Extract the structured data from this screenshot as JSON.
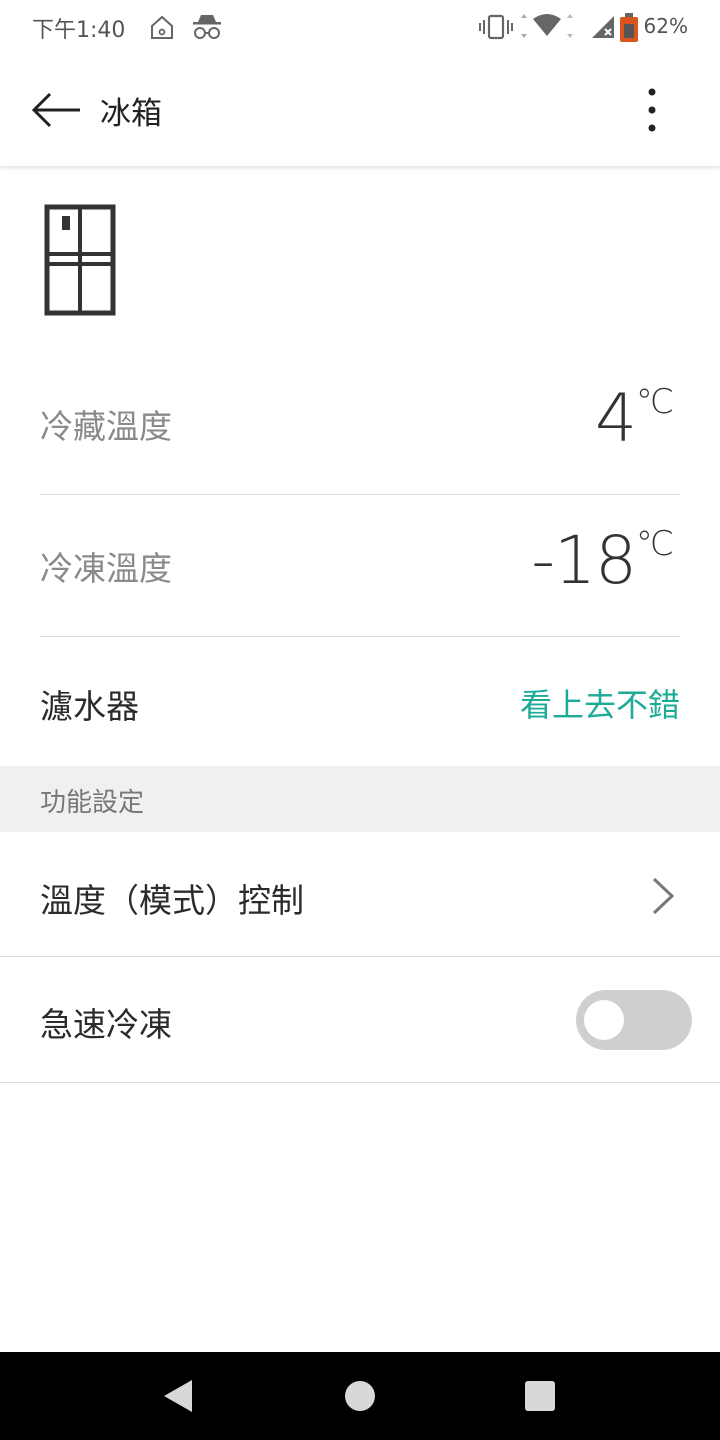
{
  "status_bar": {
    "time": "下午1:40",
    "battery": "62%",
    "icons": [
      "home-icon",
      "incognito-icon",
      "vibrate-icon",
      "wifi-icon",
      "signal-icon",
      "battery-icon"
    ]
  },
  "app_bar": {
    "title": "冰箱",
    "back_icon": "arrow-left-icon",
    "menu_icon": "more-vertical-icon"
  },
  "device": {
    "icon": "fridge-icon"
  },
  "readings": {
    "fridge_label": "冷藏溫度",
    "fridge_value": "4",
    "freezer_label": "冷凍溫度",
    "freezer_value": "-18",
    "unit": "℃",
    "filter_label": "濾水器",
    "filter_status": "看上去不錯"
  },
  "section": {
    "title": "功能設定"
  },
  "settings": {
    "mode_control_label": "溫度（模式）控制",
    "quick_freeze_label": "急速冷凍",
    "quick_freeze_on": false
  },
  "colors": {
    "accent": "#1bab97",
    "toggle_off": "#cfcfcf",
    "section_bg": "#f0f0f0"
  },
  "nav_bar": {
    "icons": [
      "back-triangle-icon",
      "home-circle-icon",
      "recents-square-icon"
    ]
  }
}
